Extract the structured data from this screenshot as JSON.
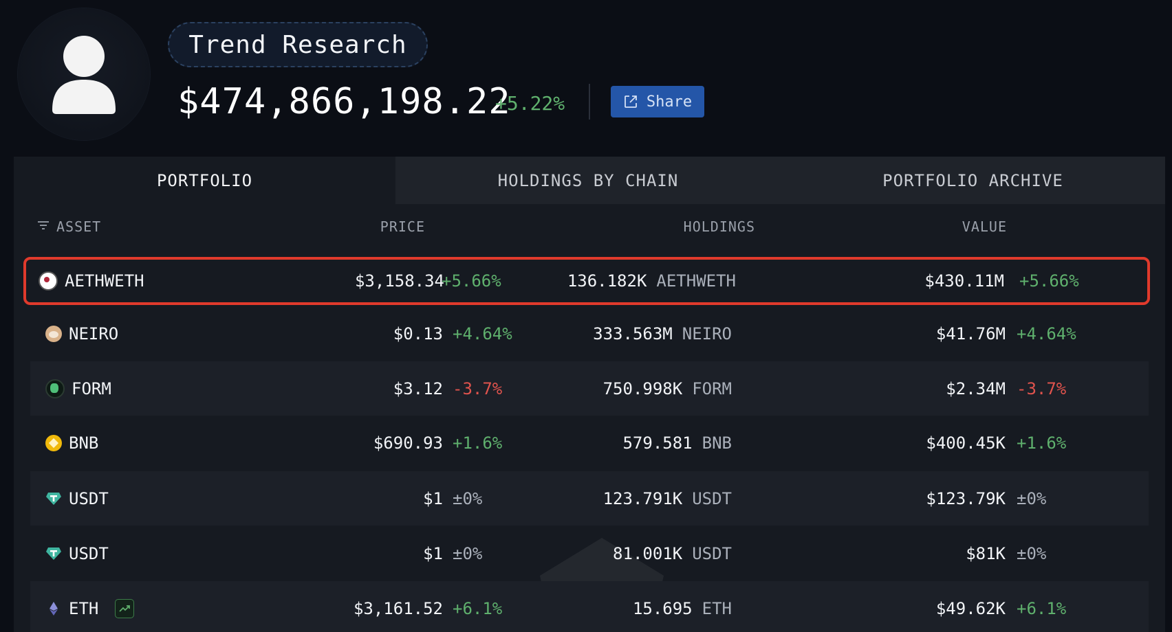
{
  "profile": {
    "name": "Trend Research",
    "balance": "$474,866,198.22",
    "balance_change": "+5.22%",
    "share_label": "Share",
    "avatar_icon": "user-silhouette-icon"
  },
  "tabs": [
    {
      "label": "PORTFOLIO",
      "active": true
    },
    {
      "label": "HOLDINGS BY CHAIN",
      "active": false
    },
    {
      "label": "PORTFOLIO ARCHIVE",
      "active": false
    }
  ],
  "columns": {
    "asset": "ASSET",
    "price": "PRICE",
    "holdings": "HOLDINGS",
    "value": "VALUE"
  },
  "rows": [
    {
      "asset": "AETHWETH",
      "price": "$3,158.34",
      "price_change": "+5.66%",
      "amount": "136.182K",
      "symbol": "AETHWETH",
      "value": "$430.11M",
      "value_change": "+5.66%",
      "highlighted": true,
      "icon": "aethweth-token-icon"
    },
    {
      "asset": "NEIRO",
      "price": "$0.13",
      "price_change": "+4.64%",
      "amount": "333.563M",
      "symbol": "NEIRO",
      "value": "$41.76M",
      "value_change": "+4.64%",
      "icon": "neiro-token-icon"
    },
    {
      "asset": "FORM",
      "price": "$3.12",
      "price_change": "-3.7%",
      "amount": "750.998K",
      "symbol": "FORM",
      "value": "$2.34M",
      "value_change": "-3.7%",
      "icon": "form-token-icon"
    },
    {
      "asset": "BNB",
      "price": "$690.93",
      "price_change": "+1.6%",
      "amount": "579.581",
      "symbol": "BNB",
      "value": "$400.45K",
      "value_change": "+1.6%",
      "icon": "bnb-token-icon"
    },
    {
      "asset": "USDT",
      "price": "$1",
      "price_change": "±0%",
      "amount": "123.791K",
      "symbol": "USDT",
      "value": "$123.79K",
      "value_change": "±0%",
      "icon": "usdt-token-icon"
    },
    {
      "asset": "USDT",
      "price": "$1",
      "price_change": "±0%",
      "amount": "81.001K",
      "symbol": "USDT",
      "value": "$81K",
      "value_change": "±0%",
      "icon": "usdt-token-icon"
    },
    {
      "asset": "ETH",
      "price": "$3,161.52",
      "price_change": "+6.1%",
      "amount": "15.695",
      "symbol": "ETH",
      "value": "$49.62K",
      "value_change": "+6.1%",
      "icon": "eth-token-icon"
    }
  ],
  "colors": {
    "positive": "#5fb06d",
    "negative": "#e0534d",
    "accent": "#2456a8",
    "highlight_border": "#e03a2c"
  }
}
